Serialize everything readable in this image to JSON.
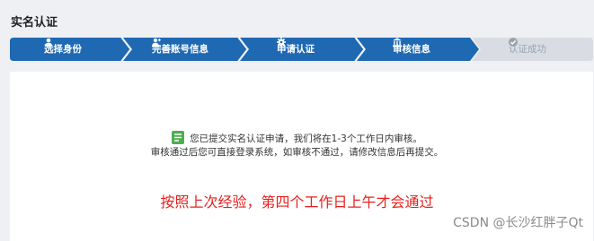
{
  "page": {
    "title": "实名认证"
  },
  "steps": [
    {
      "label": "选择身份",
      "icon": "user-icon",
      "state": "done"
    },
    {
      "label": "完善账号信息",
      "icon": "user-plus-icon",
      "state": "done"
    },
    {
      "label": "申请认证",
      "icon": "gear-icon",
      "state": "done"
    },
    {
      "label": "审核信息",
      "icon": "bank-icon",
      "state": "current"
    },
    {
      "label": "认证成功",
      "icon": "check-circle-icon",
      "state": "pending"
    }
  ],
  "colors": {
    "active": "#1f69b3",
    "inactive": "#d9dde3",
    "note": "#e8201d"
  },
  "message": {
    "icon": "document-icon",
    "line1": "您已提交实名认证申请，我们将在1-3个工作日内审核。",
    "line2": "审核通过后您可直接登录系统，如审核不通过，请修改信息后再提交。"
  },
  "annotation": "按照上次经验，第四个工作日上午才会通过",
  "watermark": "CSDN @长沙红胖子Qt"
}
